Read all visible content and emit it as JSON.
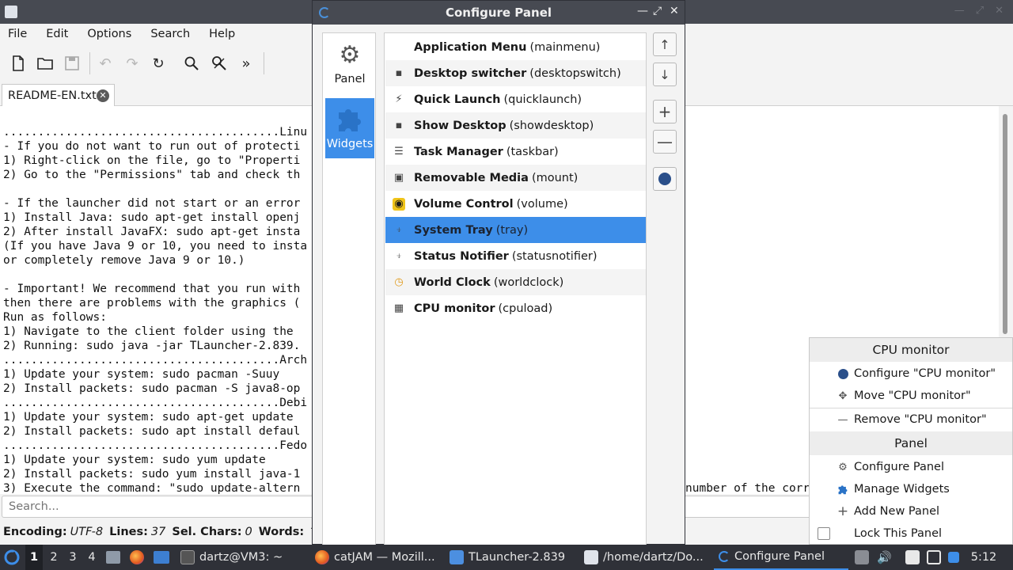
{
  "editor": {
    "menu": [
      "File",
      "Edit",
      "Options",
      "Search",
      "Help"
    ],
    "tab_label": "README-EN.txt",
    "text_lines": [
      "........................................Linu",
      "- If you do not want to run out of protecti",
      "1) Right-click on the file, go to \"Properti",
      "2) Go to the \"Permissions\" tab and check th",
      "",
      "- If the launcher did not start or an error",
      "1) Install Java: sudo apt-get install openj",
      "2) After install JavaFX: sudo apt-get insta",
      "(If you have Java 9 or 10, you need to insta",
      "or completely remove Java 9 or 10.)",
      "",
      "- Important! We recommend that you run with",
      "then there are problems with the graphics (",
      "Run as follows:",
      "1) Navigate to the client folder using the ",
      "2) Running: sudo java -jar TLauncher-2.839.",
      "........................................Arch",
      "1) Update your system: sudo pacman -Suuy",
      "2) Install packets: sudo pacman -S java8-op",
      "........................................Debi",
      "1) Update your system: sudo apt-get update",
      "2) Install packets: sudo apt install defaul",
      "........................................Fedo",
      "1) Update your system: sudo yum update",
      "2) Install packets: sudo yum install java-1",
      "3) Execute the command: \"sudo update-altern"
    ],
    "text_tail": "number of the corr",
    "search_placeholder": "Search...",
    "status": {
      "encoding_label": "Encoding:",
      "encoding_value": "UTF-8",
      "lines_label": "Lines:",
      "lines_value": "37",
      "selchars_label": "Sel. Chars:",
      "selchars_value": "0",
      "words_label": "Words:"
    }
  },
  "dialog": {
    "title": "Configure Panel",
    "sidebar": [
      {
        "label": "Panel",
        "icon": "gear-icon"
      },
      {
        "label": "Widgets",
        "icon": "puzzle-icon"
      }
    ],
    "widgets": [
      {
        "name": "Application Menu",
        "id": "(mainmenu)",
        "icon": "none"
      },
      {
        "name": "Desktop switcher",
        "id": "(desktopswitch)",
        "icon": "desktop-switch-icon"
      },
      {
        "name": "Quick Launch",
        "id": "(quicklaunch)",
        "icon": "lightning-icon"
      },
      {
        "name": "Show Desktop",
        "id": "(showdesktop)",
        "icon": "show-desktop-icon"
      },
      {
        "name": "Task Manager",
        "id": "(taskbar)",
        "icon": "taskbar-icon"
      },
      {
        "name": "Removable Media",
        "id": "(mount)",
        "icon": "drive-icon"
      },
      {
        "name": "Volume Control",
        "id": "(volume)",
        "icon": "speaker-icon"
      },
      {
        "name": "System Tray",
        "id": "(tray)",
        "icon": "tray-icon"
      },
      {
        "name": "Status Notifier",
        "id": "(statusnotifier)",
        "icon": "notifier-icon"
      },
      {
        "name": "World Clock",
        "id": "(worldclock)",
        "icon": "clock-icon"
      },
      {
        "name": "CPU monitor",
        "id": "(cpuload)",
        "icon": "cpu-icon"
      }
    ],
    "selected_index": 7,
    "buttons": [
      "move-up",
      "move-down",
      "add",
      "remove",
      "configure"
    ]
  },
  "context_menu": {
    "section1": "CPU monitor",
    "items1": [
      {
        "label": "Configure \"CPU monitor\"",
        "icon": "configure-icon"
      },
      {
        "label": "Move \"CPU monitor\"",
        "icon": "move-icon"
      },
      {
        "label": "Remove \"CPU monitor\"",
        "icon": "remove-icon"
      }
    ],
    "section2": "Panel",
    "items2": [
      {
        "label": "Configure Panel",
        "icon": "gear-icon"
      },
      {
        "label": "Manage Widgets",
        "icon": "puzzle-icon"
      },
      {
        "label": "Add New Panel",
        "icon": "plus-icon"
      },
      {
        "label": "Lock This Panel",
        "icon": "checkbox"
      }
    ]
  },
  "taskbar": {
    "desktops": [
      "1",
      "2",
      "3",
      "4"
    ],
    "active_desktop": "1",
    "tasks": [
      {
        "label": "dartz@VM3: ~",
        "icon": "terminal-icon"
      },
      {
        "label": "catJAM — Mozill...",
        "icon": "firefox-icon"
      },
      {
        "label": "TLauncher-2.839",
        "icon": "folder-icon"
      },
      {
        "label": "/home/dartz/Do...",
        "icon": "editor-icon"
      },
      {
        "label": "Configure Panel",
        "icon": "configure-panel-icon"
      }
    ],
    "clock": "5:12"
  },
  "colors": {
    "accent": "#3d8ee9",
    "titlebar": "#474a52",
    "taskbar": "#2f3138"
  }
}
